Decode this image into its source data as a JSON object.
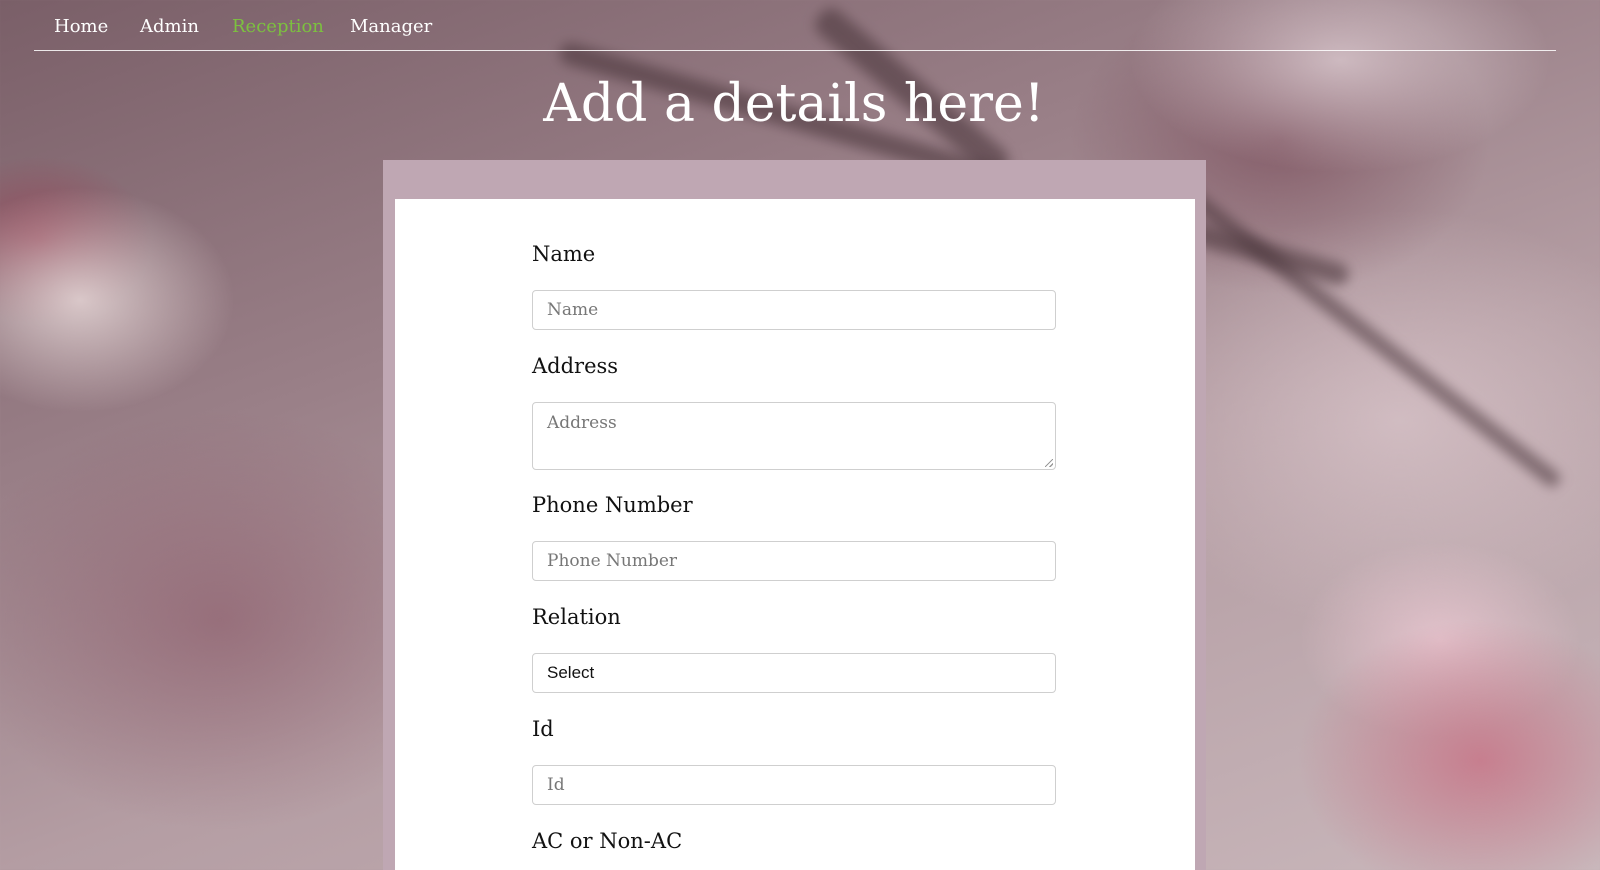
{
  "nav": {
    "items": [
      {
        "label": "Home",
        "active": false
      },
      {
        "label": "Admin",
        "active": false
      },
      {
        "label": "Reception",
        "active": true
      },
      {
        "label": "Manager",
        "active": false
      }
    ],
    "active_color": "#7cc13f"
  },
  "page": {
    "title": "Add a details here!"
  },
  "form": {
    "name": {
      "label": "Name",
      "placeholder": "Name"
    },
    "address": {
      "label": "Address",
      "placeholder": "Address"
    },
    "phone": {
      "label": "Phone Number",
      "placeholder": "Phone Number"
    },
    "relation": {
      "label": "Relation",
      "selected": "Select"
    },
    "id": {
      "label": "Id",
      "placeholder": "Id"
    },
    "ac": {
      "label": "AC or Non-AC"
    }
  },
  "colors": {
    "card_frame": "#bfa7b3",
    "card_body": "#ffffff"
  }
}
